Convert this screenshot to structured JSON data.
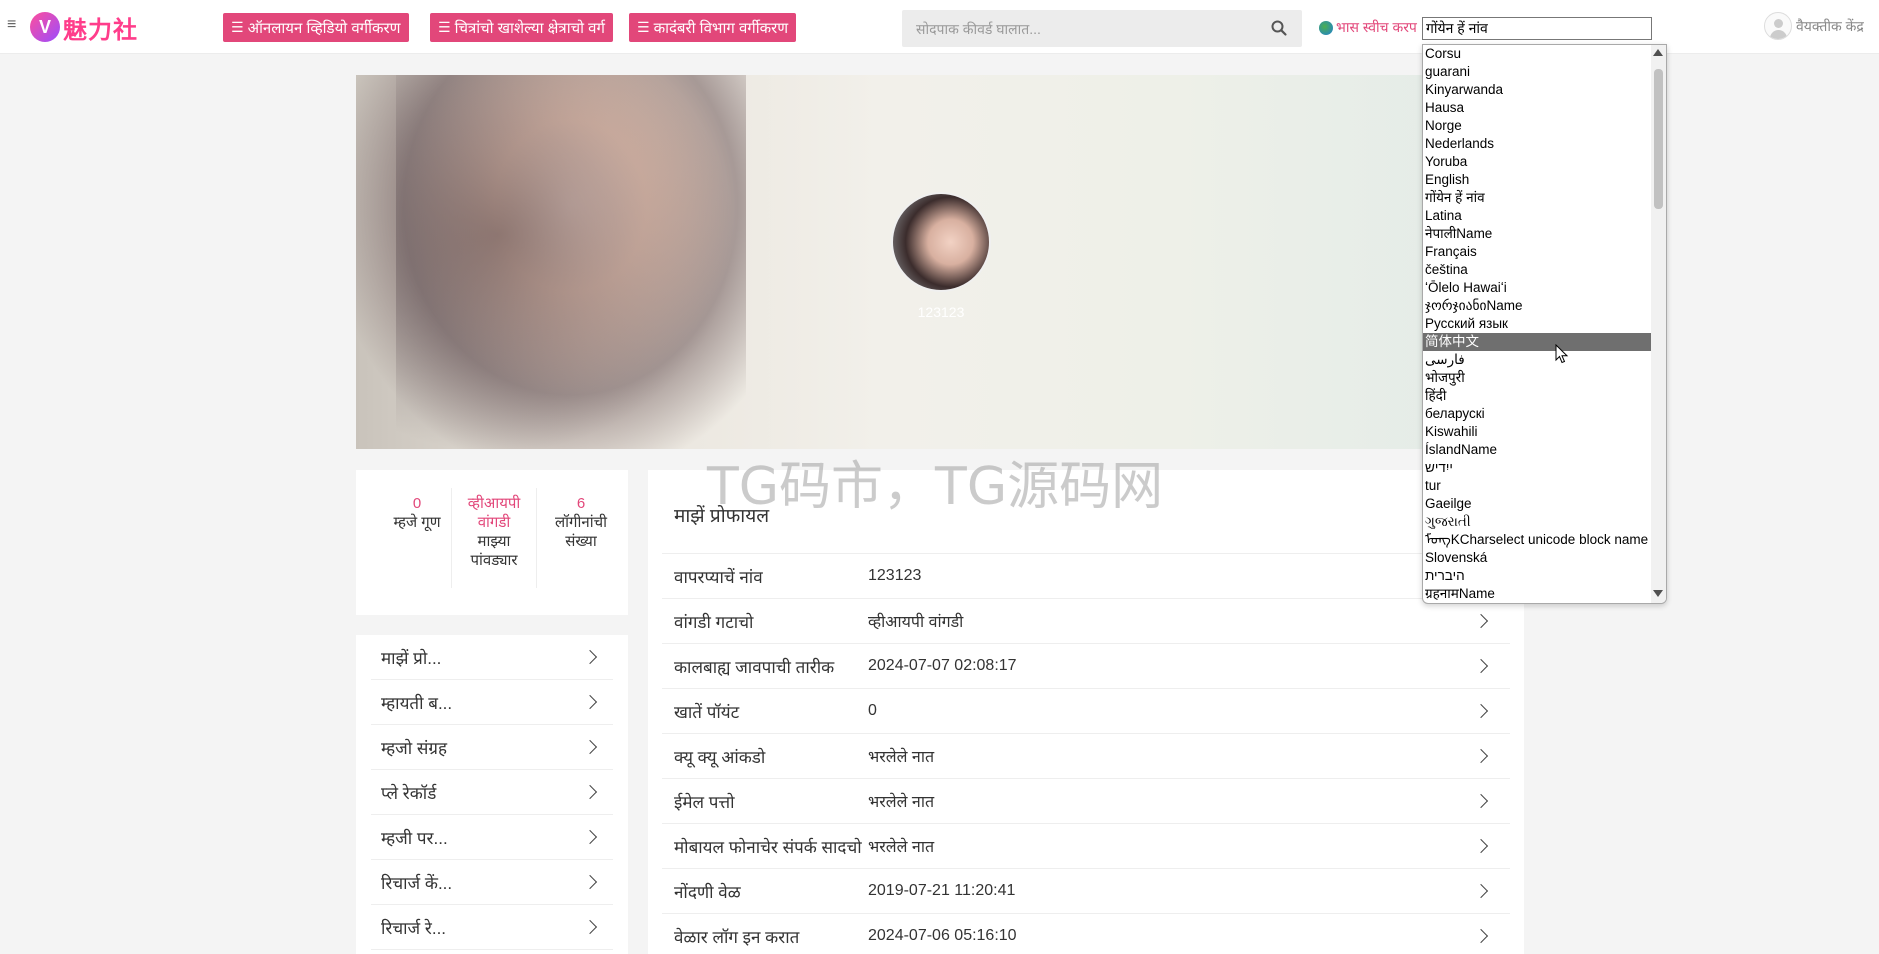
{
  "header": {
    "logo_badge": "V",
    "logo_text": "魅力社",
    "categories": [
      "ऑनलायन व्हिडियो वर्गीकरण",
      "चित्रांचो खाशेल्या क्षेत्राचो वर्ग",
      "कादंबरी विभाग वर्गीकरण"
    ],
    "search_placeholder": "सोदपाक कीवर्ड घालात...",
    "lang_switch_label": "भास स्वीच करप",
    "user_center_label": "वैयक्तीक केंद्र",
    "accent_color": "#e2477a"
  },
  "language_select": {
    "current": "गोंयेन हें नांव",
    "options": [
      "Corsu",
      "guarani",
      "Kinyarwanda",
      "Hausa",
      "Norge",
      "Nederlands",
      "Yoruba",
      "English",
      "गोंयेन हें नांव",
      "Latina",
      "नेपालीName",
      "Français",
      "čeština",
      "ʻŌlelo Hawaiʻi",
      "ჯორჯიანიName",
      "Русский язык",
      "简体中文",
      "فارسی",
      "भोजपुरी",
      "हिंदी",
      "беларускі",
      "Kiswahili",
      "ÍslandName",
      "ייִדיש",
      "tur",
      "Gaeilge",
      "ગુજરાતી",
      "ᠮᠣᠩKCharselect unicode block name",
      "Slovenská",
      "היברית",
      "ग्रहनामName"
    ],
    "highlighted": "简体中文"
  },
  "banner": {
    "username": "123123"
  },
  "stats": [
    {
      "value": "0",
      "label": "म्हजे गूण"
    },
    {
      "value": "व्हीआयपी वांगडी",
      "label": "माझ्या पांवड्यार"
    },
    {
      "value": "6",
      "label": "लॉगीनांची संख्या"
    }
  ],
  "side_menu": [
    "माझें प्रो...",
    "म्हायती ब...",
    "म्हजो संग्रह",
    "प्ले रेकॉर्ड",
    "म्हजी पर...",
    "रिचार्ज कें...",
    "रिचार्ज रे..."
  ],
  "profile": {
    "title": "माझें प्रोफायल",
    "rows": [
      {
        "key": "वापरप्याचें नांव",
        "value": "123123"
      },
      {
        "key": "वांगडी गटाचो",
        "value": "व्हीआयपी वांगडी"
      },
      {
        "key": "कालबाह्य जावपाची तारीक",
        "value": "2024-07-07 02:08:17"
      },
      {
        "key": "खातें पॉयंट",
        "value": "0"
      },
      {
        "key": "क्यू क्यू आंकडो",
        "value": "भरलेले नात"
      },
      {
        "key": "ईमेल पत्तो",
        "value": "भरलेले नात"
      },
      {
        "key": "मोबायल फोनाचेर संपर्क सादचो",
        "value": "भरलेले नात"
      },
      {
        "key": "नोंदणी वेळ",
        "value": "2019-07-21 11:20:41"
      },
      {
        "key": "वेळार लॉग इन करात",
        "value": "2024-07-06 05:16:10"
      }
    ]
  },
  "watermark": "TG码市，TG源码网"
}
